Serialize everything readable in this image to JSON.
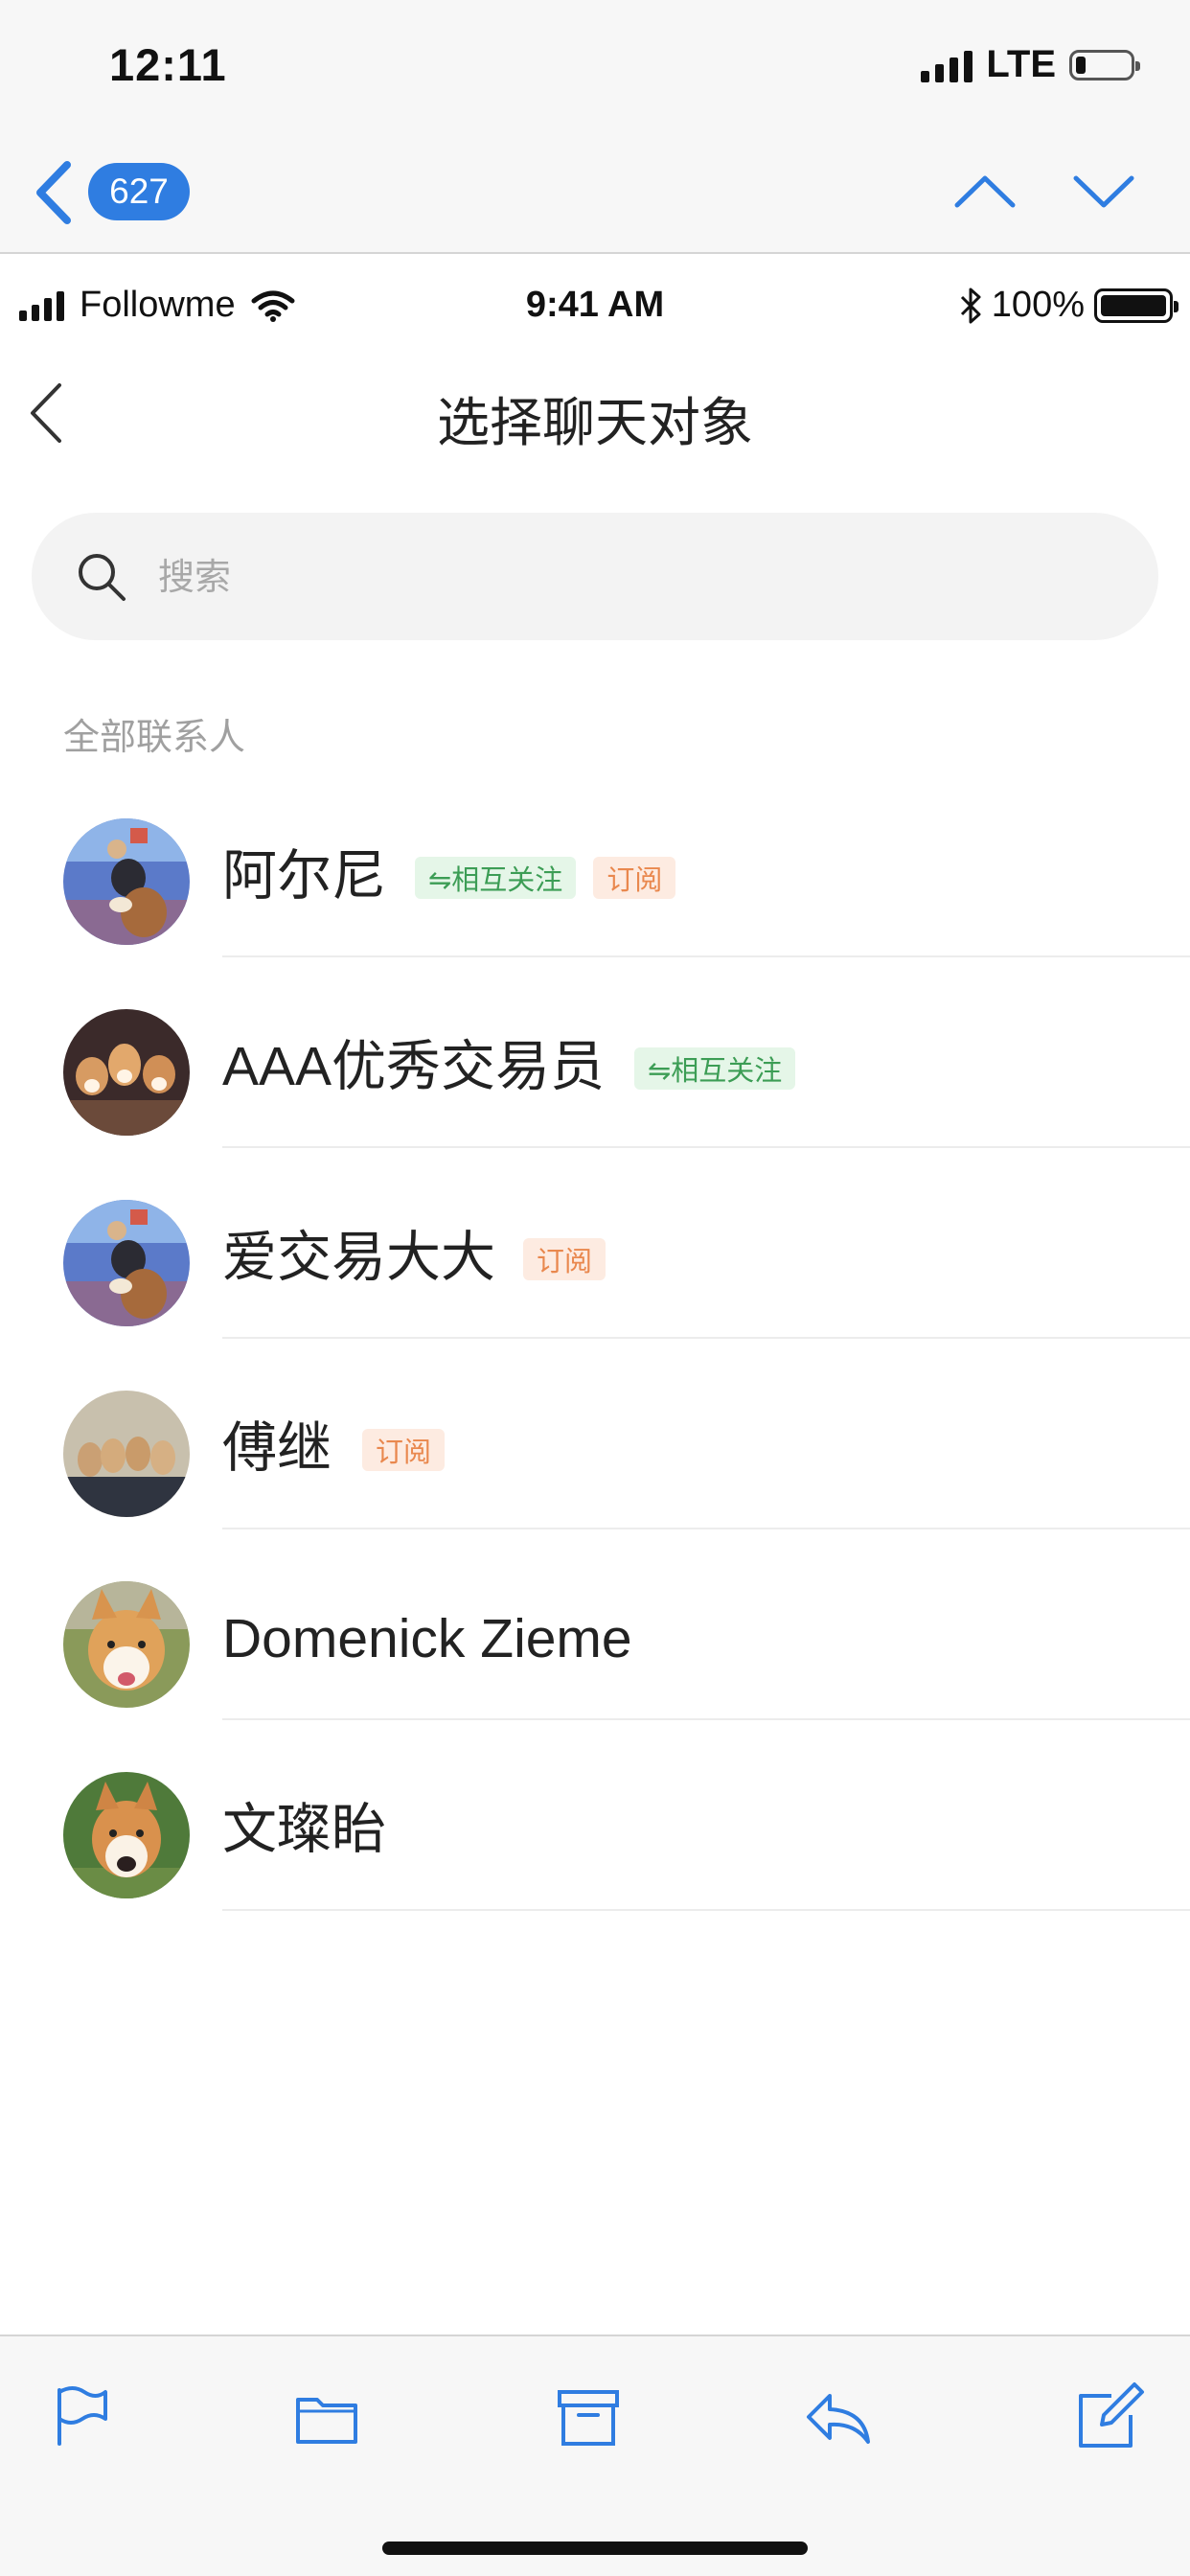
{
  "os_status": {
    "time": "12:11",
    "network": "LTE"
  },
  "mail_nav": {
    "unread_count": "627"
  },
  "inner_status": {
    "carrier": "Followme",
    "time": "9:41 AM",
    "battery": "100%"
  },
  "header": {
    "title": "选择聊天对象"
  },
  "search": {
    "placeholder": "搜索"
  },
  "section": {
    "label": "全部联系人"
  },
  "contacts": [
    {
      "name": "阿尔尼",
      "tags": [
        "⇋相互关注",
        "订阅"
      ]
    },
    {
      "name": "AAA优秀交易员",
      "tags": [
        "⇋相互关注"
      ]
    },
    {
      "name": "爱交易大大",
      "tags": [
        "订阅"
      ]
    },
    {
      "name": "傅继",
      "tags": [
        "订阅"
      ]
    },
    {
      "name": "Domenick Zieme",
      "tags": []
    },
    {
      "name": "文璨眙",
      "tags": []
    }
  ],
  "toolbar": {
    "icons": [
      "flag-icon",
      "folder-icon",
      "archive-icon",
      "reply-icon",
      "compose-icon"
    ],
    "accent": "#2f7de1"
  }
}
